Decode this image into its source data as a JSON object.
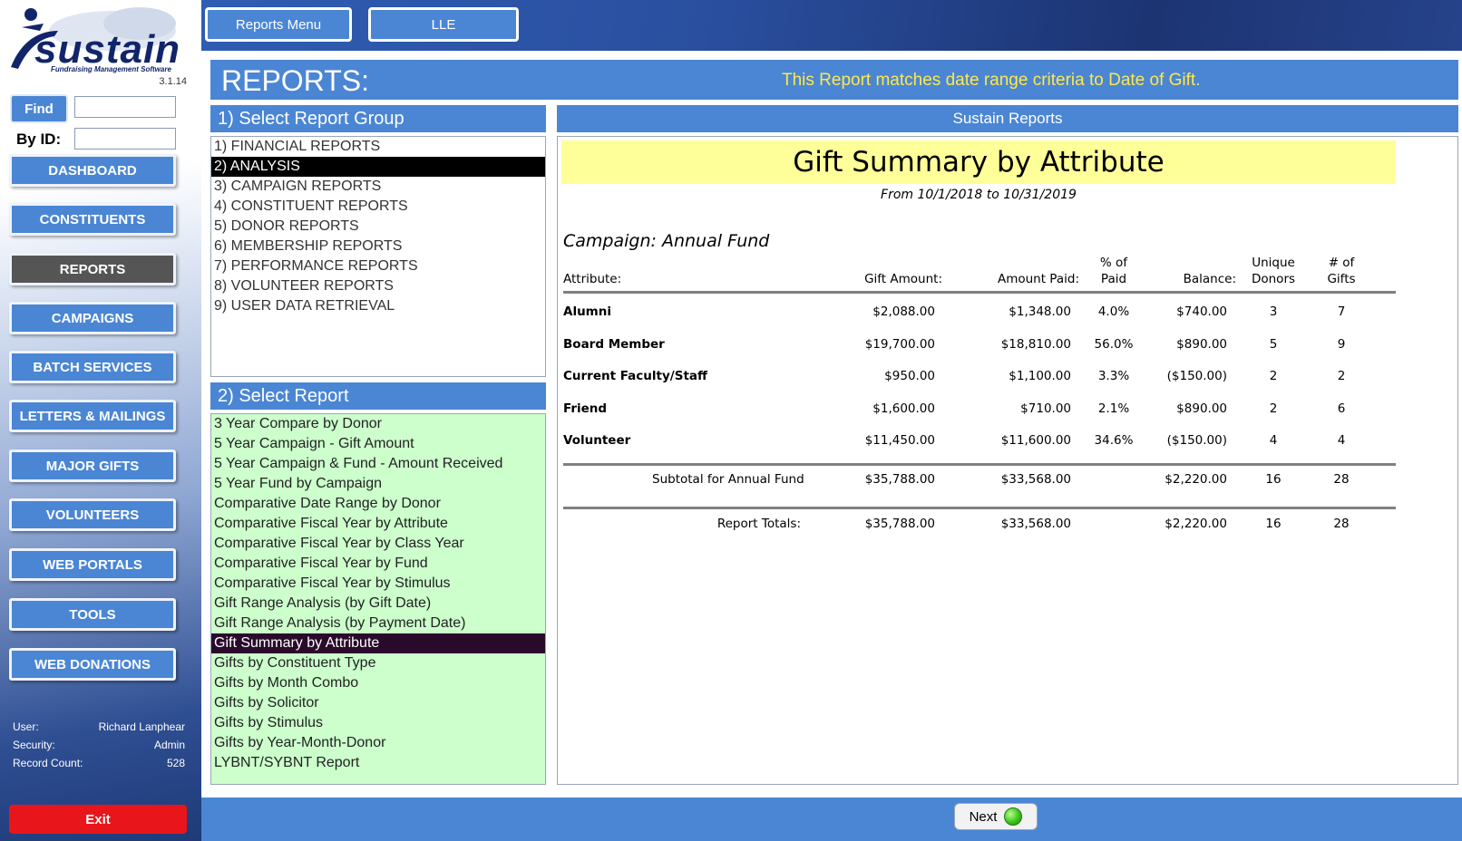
{
  "app": {
    "logo_text": "sustain",
    "logo_sub": "Fundraising Management Software",
    "version": "3.1.14"
  },
  "sidebar": {
    "find_label": "Find",
    "byid_label": "By ID:",
    "nav": [
      "DASHBOARD",
      "CONSTITUENTS",
      "REPORTS",
      "CAMPAIGNS",
      "BATCH SERVICES",
      "LETTERS & MAILINGS",
      "MAJOR GIFTS",
      "VOLUNTEERS",
      "WEB PORTALS",
      "TOOLS",
      "WEB DONATIONS"
    ],
    "active_nav": "REPORTS",
    "user_label": "User:",
    "user_value": "Richard Lanphear",
    "security_label": "Security:",
    "security_value": "Admin",
    "count_label": "Record Count:",
    "count_value": "528",
    "exit_label": "Exit"
  },
  "topbar": {
    "reports_menu": "Reports Menu",
    "lle": "LLE"
  },
  "main": {
    "title": "REPORTS:",
    "note": "This Report matches date range criteria to Date of Gift.",
    "group_heading": "1) Select Report Group",
    "groups": [
      "1) FINANCIAL REPORTS",
      "2) ANALYSIS",
      "3) CAMPAIGN REPORTS",
      "4) CONSTITUENT REPORTS",
      "5) DONOR REPORTS",
      "6) MEMBERSHIP REPORTS",
      "7) PERFORMANCE REPORTS",
      "8) VOLUNTEER REPORTS",
      "9) USER DATA RETRIEVAL"
    ],
    "selected_group": "2) ANALYSIS",
    "report_heading": "2) Select Report",
    "reports": [
      "3 Year Compare by Donor",
      "5 Year Campaign - Gift Amount",
      "5 Year Campaign & Fund - Amount Received",
      "5 Year Fund by Campaign",
      "Comparative Date Range by Donor",
      "Comparative Fiscal Year by Attribute",
      "Comparative Fiscal Year by Class Year",
      "Comparative Fiscal Year by Fund",
      "Comparative Fiscal Year by Stimulus",
      "Gift Range Analysis (by Gift Date)",
      "Gift Range Analysis (by Payment Date)",
      "Gift Summary by Attribute",
      "Gifts by Constituent Type",
      "Gifts by Month Combo",
      "Gifts by Solicitor",
      "Gifts by Stimulus",
      "Gifts by Year-Month-Donor",
      "LYBNT/SYBNT Report"
    ],
    "selected_report": "Gift Summary by Attribute",
    "preview_heading": "Sustain Reports"
  },
  "report": {
    "title": "Gift Summary by Attribute",
    "range": "From 10/1/2018 to 10/31/2019",
    "campaign": "Campaign: Annual Fund",
    "headers": {
      "attribute": "Attribute:",
      "gift_amount": "Gift Amount:",
      "amount_paid": "Amount Paid:",
      "pct_paid_1": "% of",
      "pct_paid_2": "Paid",
      "balance": "Balance:",
      "unique_1": "Unique",
      "unique_2": "Donors",
      "gifts_1": "# of",
      "gifts_2": "Gifts"
    },
    "rows": [
      {
        "attribute": "Alumni",
        "gift": "$2,088.00",
        "paid": "$1,348.00",
        "pct": "4.0%",
        "balance": "$740.00",
        "donors": "3",
        "gifts": "7"
      },
      {
        "attribute": "Board Member",
        "gift": "$19,700.00",
        "paid": "$18,810.00",
        "pct": "56.0%",
        "balance": "$890.00",
        "donors": "5",
        "gifts": "9"
      },
      {
        "attribute": "Current Faculty/Staff",
        "gift": "$950.00",
        "paid": "$1,100.00",
        "pct": "3.3%",
        "balance": "($150.00)",
        "donors": "2",
        "gifts": "2"
      },
      {
        "attribute": "Friend",
        "gift": "$1,600.00",
        "paid": "$710.00",
        "pct": "2.1%",
        "balance": "$890.00",
        "donors": "2",
        "gifts": "6"
      },
      {
        "attribute": "Volunteer",
        "gift": "$11,450.00",
        "paid": "$11,600.00",
        "pct": "34.6%",
        "balance": "($150.00)",
        "donors": "4",
        "gifts": "4"
      }
    ],
    "subtotal": {
      "label": "Subtotal for Annual Fund",
      "gift": "$35,788.00",
      "paid": "$33,568.00",
      "balance": "$2,220.00",
      "donors": "16",
      "gifts": "28"
    },
    "totals": {
      "label": "Report Totals:",
      "gift": "$35,788.00",
      "paid": "$33,568.00",
      "balance": "$2,220.00",
      "donors": "16",
      "gifts": "28"
    }
  },
  "bottom": {
    "next_label": "Next"
  }
}
